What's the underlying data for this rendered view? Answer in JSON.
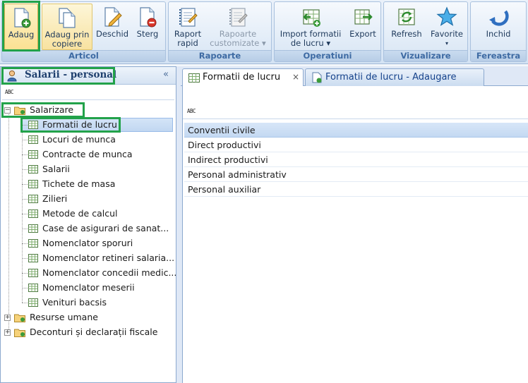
{
  "ribbon": {
    "groups": [
      {
        "title": "Articol"
      },
      {
        "title": "Rapoarte"
      },
      {
        "title": "Operatiuni"
      },
      {
        "title": "Vizualizare"
      },
      {
        "title": "Fereastra"
      }
    ],
    "buttons": {
      "adaug": {
        "line1": "Adaug",
        "line2": ""
      },
      "adaug_prin_copiere": {
        "line1": "Adaug prin",
        "line2": "copiere"
      },
      "deschid": {
        "line1": "Deschid",
        "line2": ""
      },
      "sterg": {
        "line1": "Sterg",
        "line2": ""
      },
      "raport_rapid": {
        "line1": "Raport",
        "line2": "rapid"
      },
      "rapoarte_customizate": {
        "line1": "Rapoarte",
        "line2": "customizate ▾"
      },
      "import_formatii": {
        "line1": "Import formatii",
        "line2": "de lucru ▾"
      },
      "export": {
        "line1": "Export",
        "line2": ""
      },
      "refresh": {
        "line1": "Refresh",
        "line2": ""
      },
      "favorite": {
        "line1": "Favorite",
        "line2": "▾"
      },
      "inchid": {
        "line1": "Inchid",
        "line2": ""
      }
    }
  },
  "left_panel": {
    "title": "Salarii - personal",
    "collapse_glyph": "«",
    "filter_glyph": "ABC",
    "tree": {
      "root": {
        "label": "Salarizare",
        "expander": "−"
      },
      "children": [
        {
          "label": "Formatii de lucru"
        },
        {
          "label": "Locuri de munca"
        },
        {
          "label": "Contracte de munca"
        },
        {
          "label": "Salarii"
        },
        {
          "label": "Tichete de masa"
        },
        {
          "label": "Zilieri"
        },
        {
          "label": "Metode de calcul"
        },
        {
          "label": "Case de asigurari de sanat..."
        },
        {
          "label": "Nomenclator sporuri"
        },
        {
          "label": "Nomenclator retineri salaria..."
        },
        {
          "label": "Nomenclator concedii medic..."
        },
        {
          "label": "Nomenclator meserii"
        },
        {
          "label": "Venituri bacsis"
        }
      ],
      "siblings": [
        {
          "label": "Resurse umane",
          "expander": "+"
        },
        {
          "label": "Deconturi și declarații fiscale",
          "expander": "+"
        }
      ]
    }
  },
  "tabs": [
    {
      "label": "Formatii de lucru",
      "close": "×"
    },
    {
      "label": "Formatii de lucru - Adaugare"
    }
  ],
  "grid": {
    "filter_glyph": "ABC",
    "rows": [
      {
        "label": "Conventii civile"
      },
      {
        "label": "Direct productivi"
      },
      {
        "label": "Indirect productivi"
      },
      {
        "label": "Personal administrativ"
      },
      {
        "label": "Personal auxiliar"
      }
    ]
  },
  "colors": {
    "highlight": "#22a24a",
    "ribbon_label": "#1e395b",
    "selection": "#c4d9f2"
  },
  "icons": {
    "adaug": "document-add-icon",
    "adaug_prin_copiere": "documents-copy-icon",
    "deschid": "document-edit-icon",
    "sterg": "document-delete-icon",
    "raport_rapid": "report-icon",
    "rapoarte_customizate": "report-custom-icon",
    "import_formatii": "import-icon",
    "export": "export-icon",
    "refresh": "refresh-icon",
    "favorite": "star-icon",
    "inchid": "close-window-icon"
  }
}
